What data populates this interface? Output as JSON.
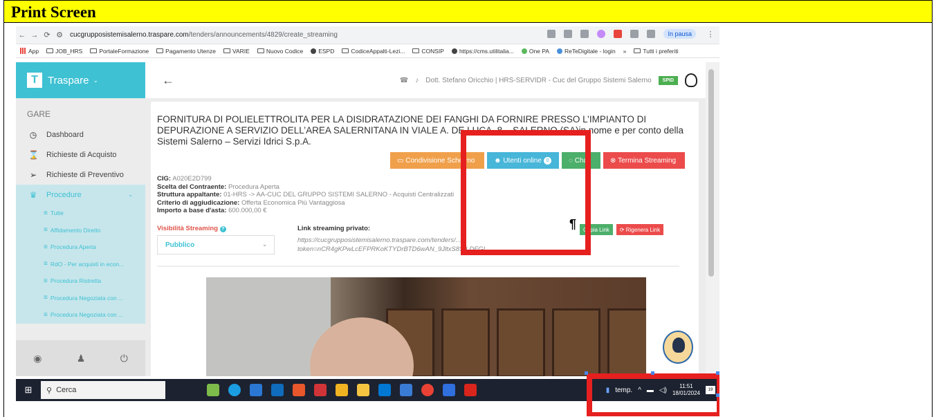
{
  "caption": "Print Screen",
  "browser": {
    "url_domain": "cucgrupposistemisalerno.traspare.com",
    "url_path": "/tenders/announcements/4829/create_streaming",
    "pause_label": "In pausa",
    "bookmarks": [
      "App",
      "JOB_HRS",
      "PortaleFormazione",
      "Pagamento Utenze",
      "VARIE",
      "Nuovo Codice",
      "ESPD",
      "CodiceAppalti-Lezi...",
      "CONSIP",
      "https://cms.utilitalia...",
      "One PA",
      "ReTeDigitale - login",
      "»",
      "Tutti i preferiti"
    ]
  },
  "sidebar": {
    "brand": "Traspare",
    "section": "GARE",
    "items": [
      {
        "label": "Dashboard",
        "icon": "dashboard-icon"
      },
      {
        "label": "Richieste di Acquisto",
        "icon": "hourglass-icon"
      },
      {
        "label": "Richieste di Preventivo",
        "icon": "send-icon"
      },
      {
        "label": "Procedure",
        "icon": "trophy-icon"
      }
    ],
    "sub_items": [
      "Tutte",
      "Affidamento Diretto",
      "Procedura Aperta",
      "RdO - Per acquisti in econ...",
      "Procedura Ristretta",
      "Procedura Negoziata con ...",
      "Procedura Negoziata con ..."
    ]
  },
  "topbar": {
    "user": "Dott. Stefano Oricchio | HRS-SERVIDR - Cuc del Gruppo Sistemi Salerno",
    "badge": "SPID"
  },
  "tender": {
    "title": "FORNITURA DI POLIELETTROLITA PER LA DISIDRATAZIONE DEI FANGHI DA FORNIRE PRESSO L’IMPIANTO DI DEPURAZIONE A SERVIZIO DELL’AREA SALERNITANA IN VIALE A. DE LUCA, 8 – SALERNO (SA)in nome e per conto della Sistemi Salerno – Servizi Idrici S.p.A.",
    "buttons": {
      "share": "Condivisione Schermo",
      "online": "Utenti online",
      "online_count": "0",
      "chat": "Chat",
      "end": "Termina Streaming"
    },
    "cig_label": "CIG:",
    "cig": "A020E2D799",
    "contractor_label": "Scelta del Contraente:",
    "contractor": "Procedura Aperta",
    "structure_label": "Struttura appaltante:",
    "structure": "01-HRS -> AA-CUC DEL GRUPPO SISTEMI SALERNO - Acquisti Centralizzati",
    "criterion_label": "Criterio di aggiudicazione:",
    "criterion": "Offerta Economica Più Vantaggiosa",
    "amount_label": "Importo a base d'asta:",
    "amount": "600.000,00 €",
    "visibility_label": "Visibilità Streaming",
    "visibility_value": "Pubblico",
    "link_label": "Link streaming privato:",
    "link_line1": "https://cucgrupposistemisalerno.traspare.com/tenders/...",
    "link_line2": "token=nCR4gKPwLcEFPRKoKTYDrBTD6wAN_9JltxS8StLDFGI",
    "copy_label": "Copia Link",
    "regen_label": "Rigenera Link"
  },
  "taskbar": {
    "search": "Cerca",
    "weather": "temp.",
    "time": "11:51",
    "date": "18/01/2024",
    "notifications": "19"
  },
  "colors": {
    "highlight": "#e5201f",
    "accent": "#3ec1d3",
    "caption_bg": "#ffff00"
  }
}
